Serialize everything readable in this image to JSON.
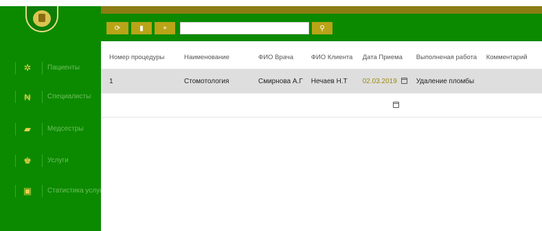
{
  "toolbar": {
    "buttons": [
      {
        "icon": "refresh-icon",
        "glyph": "⟳"
      },
      {
        "icon": "trash-icon",
        "glyph": "▮"
      },
      {
        "icon": "add-icon",
        "glyph": "+"
      }
    ],
    "search_value": "",
    "search_button_glyph": "⚲"
  },
  "sidebar": {
    "items": [
      {
        "label": "Пациенты",
        "icon": "gear-icon",
        "glyph": "✲"
      },
      {
        "label": "Специалисты",
        "icon": "hryvnia-icon",
        "glyph": "₦"
      },
      {
        "label": "Медсестры",
        "icon": "truck-icon",
        "glyph": "▰"
      },
      {
        "label": "Услуги",
        "icon": "crown-icon",
        "glyph": "♚"
      },
      {
        "label": "Статистика услуг",
        "icon": "chart-icon",
        "glyph": "▣"
      }
    ]
  },
  "table": {
    "columns": [
      "Номер процедуры",
      "Наименование",
      "ФИО Врача",
      "ФИО Клиента",
      "Дата Приема",
      "Выполненая работа",
      "Комментарий"
    ],
    "rows": [
      {
        "num": "1",
        "name": "Стомотология",
        "doctor": "Смирнова А.Г",
        "client": "Нечаев Н.Т",
        "date": "02.03.2019",
        "work": "Удаление пломбы",
        "comment": ""
      },
      {
        "num": "",
        "name": "",
        "doctor": "",
        "client": "",
        "date": "",
        "work": "",
        "comment": ""
      }
    ]
  },
  "colors": {
    "sidebar": "#0b8a00",
    "accent": "#b9a417",
    "gold_bar": "#8a7d12"
  }
}
